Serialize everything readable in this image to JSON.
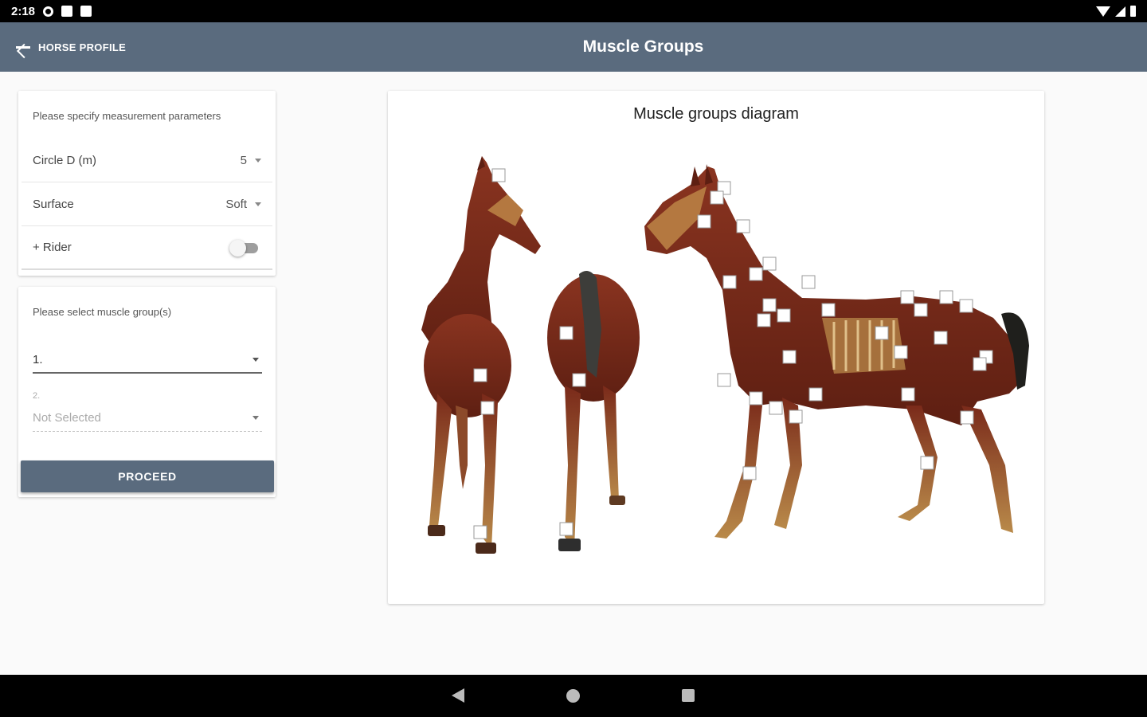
{
  "status_bar": {
    "time": "2:18"
  },
  "app_bar": {
    "back_label": "HORSE PROFILE",
    "title": "Muscle Groups"
  },
  "params": {
    "heading": "Please specify measurement parameters",
    "circle_label": "Circle D (m)",
    "circle_value": "5",
    "surface_label": "Surface",
    "surface_value": "Soft",
    "rider_label": "+ Rider",
    "rider_enabled": false
  },
  "muscle": {
    "heading": "Please select muscle group(s)",
    "select1_value": "1.",
    "select2_label": "2.",
    "select2_value": "Not Selected",
    "proceed_label": "PROCEED"
  },
  "diagram": {
    "title": "Muscle groups diagram"
  },
  "colors": {
    "primary": "#5a6b7e",
    "muscle": "#7a2a1a",
    "tendon": "#b98a4a"
  },
  "icons": [
    "back-arrow-icon",
    "chevron-down-icon",
    "toggle-switch",
    "nav-back-icon",
    "nav-home-icon",
    "nav-recents-icon"
  ]
}
